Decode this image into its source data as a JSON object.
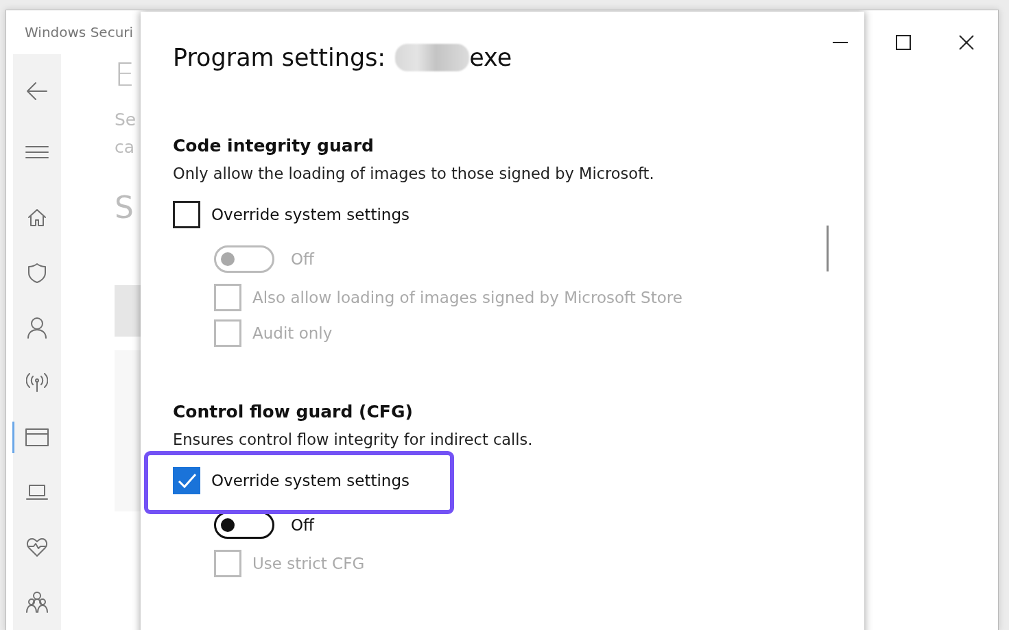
{
  "window": {
    "title": "Windows Securi"
  },
  "sidebar": {
    "items": [
      {
        "kind": "back",
        "selected": false
      },
      {
        "kind": "menu",
        "selected": false
      },
      {
        "kind": "home",
        "selected": false
      },
      {
        "kind": "shield",
        "selected": false
      },
      {
        "kind": "person",
        "selected": false
      },
      {
        "kind": "antenna",
        "selected": false
      },
      {
        "kind": "browser",
        "selected": true
      },
      {
        "kind": "laptop",
        "selected": false
      },
      {
        "kind": "heart",
        "selected": false
      },
      {
        "kind": "family",
        "selected": false
      }
    ]
  },
  "background_page": {
    "heading": "E",
    "description_lines": [
      "Se",
      "ca"
    ],
    "subheading": "S"
  },
  "dialog": {
    "title": "Program settings:",
    "title_suffix": "exe",
    "sections": [
      {
        "heading": "Code integrity guard",
        "description": "Only allow the loading of images to those signed by Microsoft.",
        "override": {
          "label": "Override system settings",
          "checked": false,
          "highlighted": false
        },
        "toggle": {
          "label": "Off",
          "on": false,
          "disabled": true
        },
        "options": [
          {
            "label": "Also allow loading of images signed by Microsoft Store",
            "checked": false,
            "disabled": true
          },
          {
            "label": "Audit only",
            "checked": false,
            "disabled": true
          }
        ]
      },
      {
        "heading": "Control flow guard (CFG)",
        "description": "Ensures control flow integrity for indirect calls.",
        "override": {
          "label": "Override system settings",
          "checked": true,
          "highlighted": true
        },
        "toggle": {
          "label": "Off",
          "on": false,
          "disabled": false
        },
        "options": [
          {
            "label": "Use strict CFG",
            "checked": false,
            "disabled": true
          }
        ]
      }
    ]
  }
}
